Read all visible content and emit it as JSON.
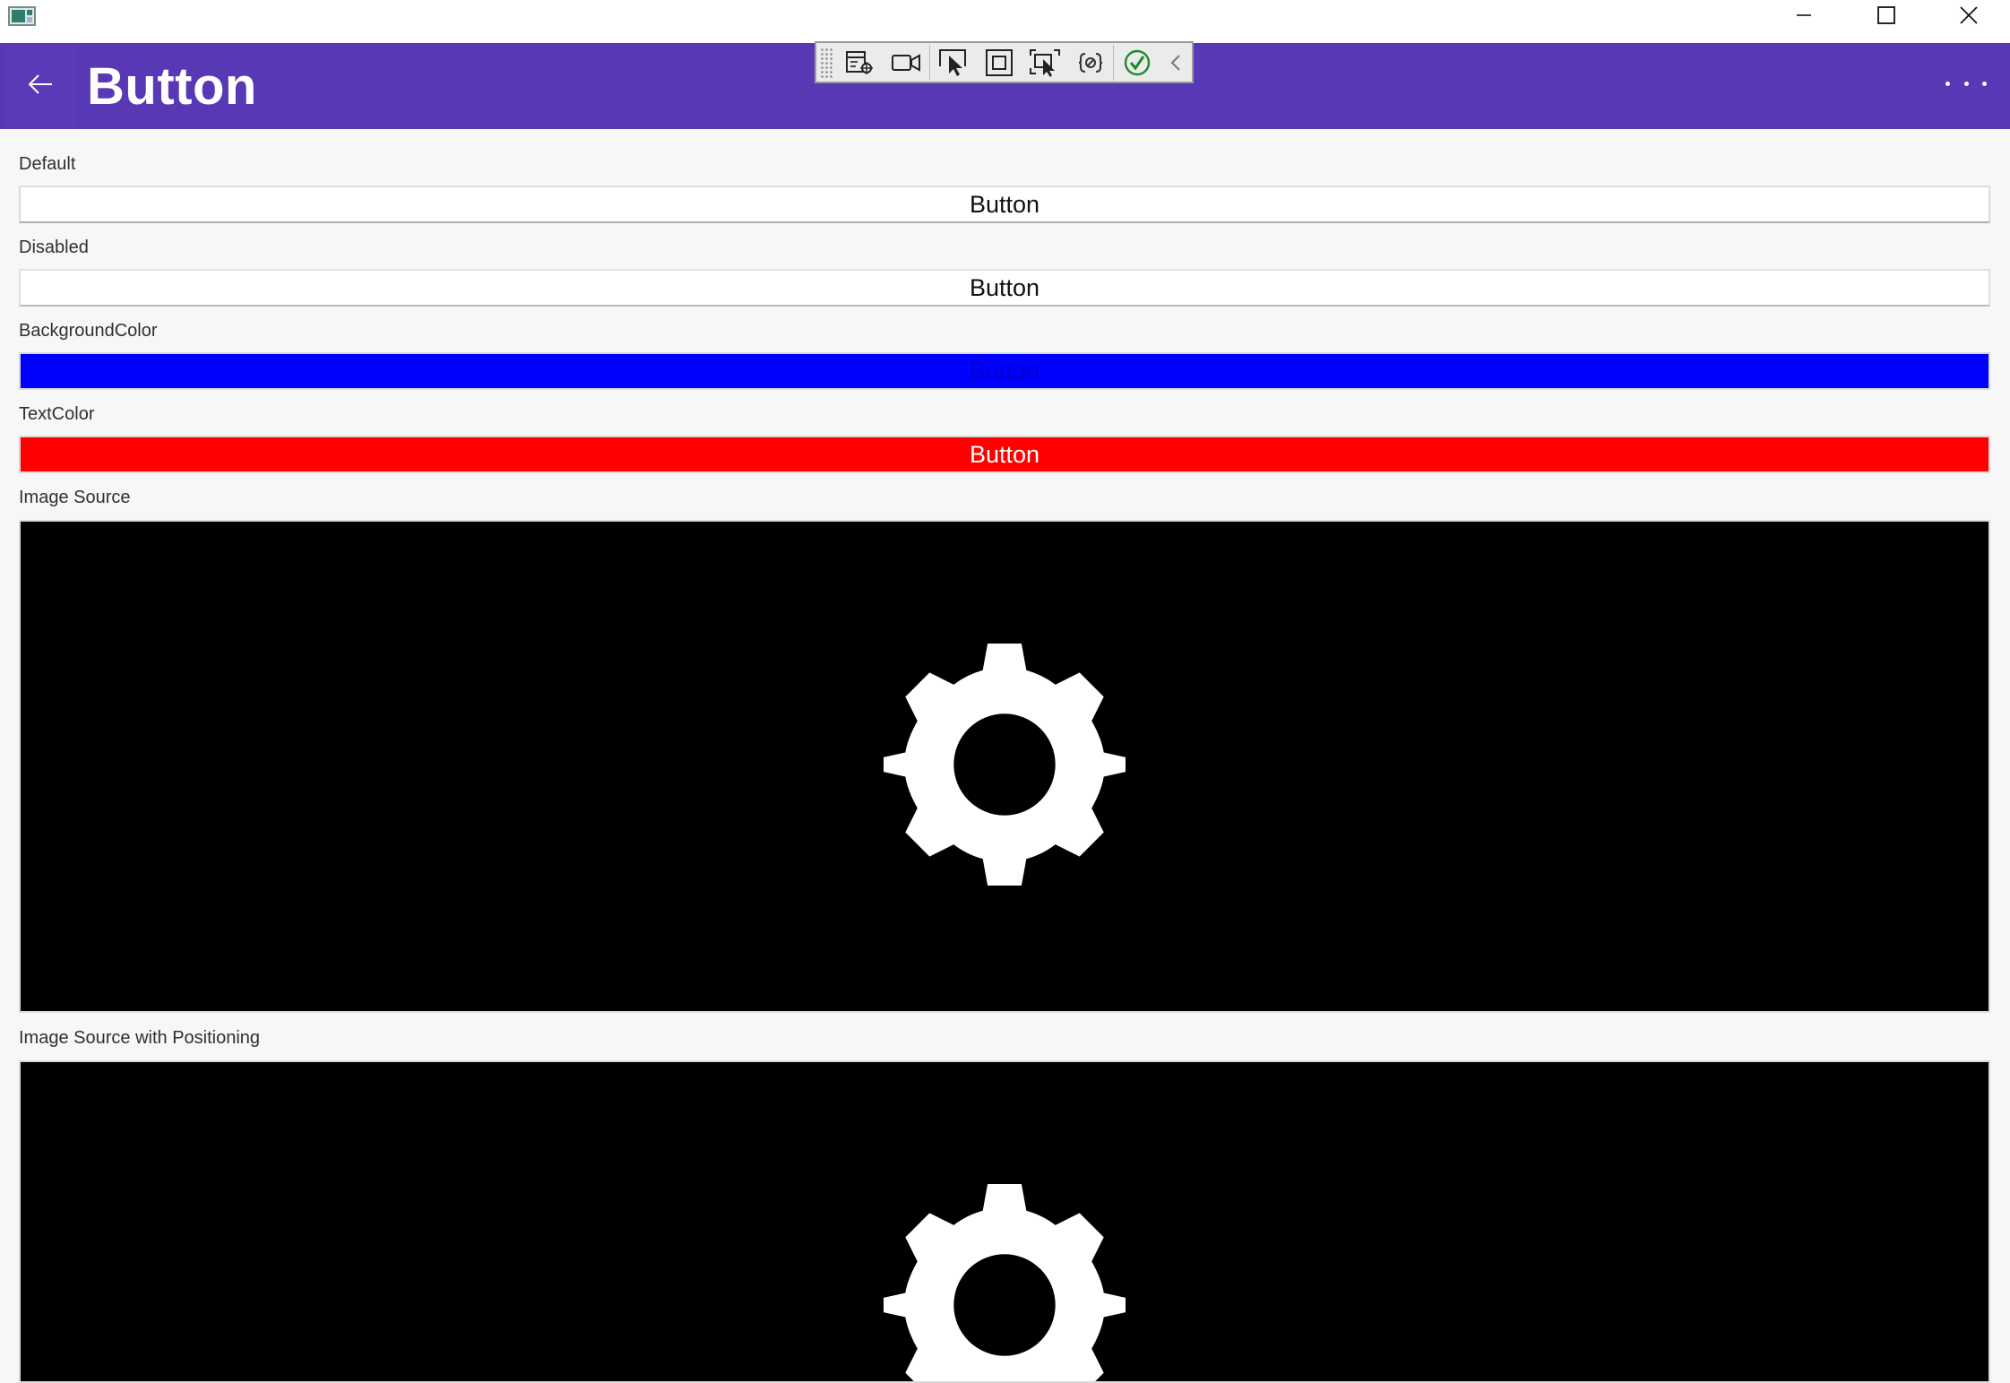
{
  "window": {
    "title": "",
    "controls": {
      "minimize_icon": "minimize-icon",
      "maximize_icon": "maximize-icon",
      "close_icon": "close-icon"
    }
  },
  "nav": {
    "title": "Button",
    "back_icon": "arrow-left-icon",
    "more_icon": "more-horizontal-icon",
    "bar_color": "#5838b4"
  },
  "debug_toolbar": {
    "items": [
      "live-visual-tree-icon",
      "video-record-icon",
      "select-element-icon",
      "display-layout-adorners-icon",
      "track-focused-element-icon",
      "binding-failures-icon",
      "hot-reload-ok-icon",
      "collapse-chevron-icon"
    ]
  },
  "sections": [
    {
      "label": "Default",
      "button_text": "Button",
      "background": "#ffffff",
      "text_color": "#111111"
    },
    {
      "label": "Disabled",
      "button_text": "Button",
      "background": "#ffffff",
      "text_color": "#111111"
    },
    {
      "label": "BackgroundColor",
      "button_text": "Button",
      "background": "#0000ff",
      "text_color": "#0000cc"
    },
    {
      "label": "TextColor",
      "button_text": "Button",
      "background": "#ff0000",
      "text_color": "#ffffff"
    },
    {
      "label": "Image Source",
      "image_icon": "gear-icon",
      "background": "#000000"
    },
    {
      "label": "Image Source with Positioning",
      "image_icon": "gear-icon",
      "background": "#000000"
    }
  ]
}
